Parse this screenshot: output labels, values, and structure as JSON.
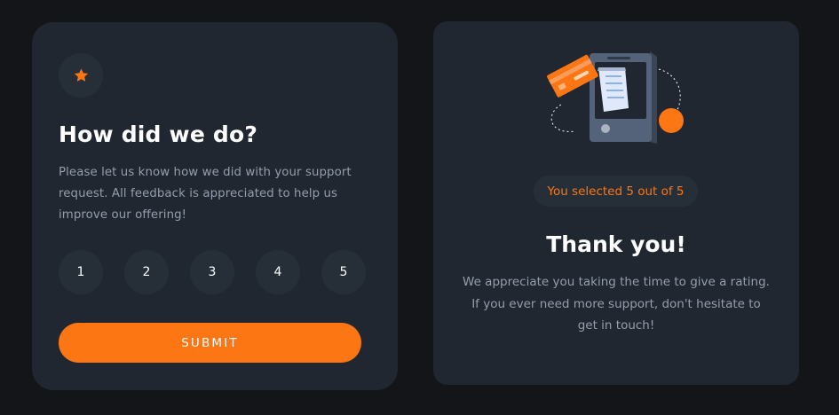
{
  "rating_card": {
    "title": "How did we do?",
    "description": "Please let us know how we did with your support request. All feedback is appreciated to help us improve our offering!",
    "ratings": [
      "1",
      "2",
      "3",
      "4",
      "5"
    ],
    "submit_label": "SUBMIT"
  },
  "thanks_card": {
    "selection": "You selected 5 out of 5",
    "title": "Thank you!",
    "body": "We appreciate you taking the time to give a rating. If you ever need more support, don't hesitate to get in touch!"
  },
  "colors": {
    "background": "#131518",
    "card": "#202731",
    "circle": "#262f38",
    "accent": "#fc7614",
    "muted_text": "#959eac",
    "white": "#ffffff"
  },
  "icons": {
    "star": "star-icon",
    "illustration": "phone-payment-illustration"
  }
}
